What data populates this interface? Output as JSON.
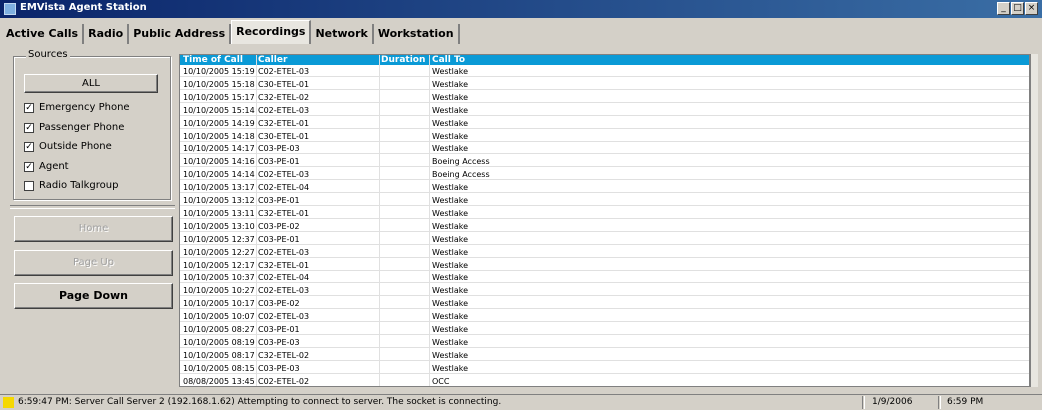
{
  "window": {
    "title": "EMVista Agent Station",
    "buttons": [
      "_",
      "□",
      "×"
    ]
  },
  "tabs": [
    {
      "label": "Active Calls",
      "active": false
    },
    {
      "label": "Radio",
      "active": false
    },
    {
      "label": "Public Address",
      "active": false
    },
    {
      "label": "Recordings",
      "active": true
    },
    {
      "label": "Network",
      "active": false
    },
    {
      "label": "Workstation",
      "active": false
    }
  ],
  "sources": {
    "legend": "Sources",
    "all_label": "ALL",
    "checks": [
      {
        "label": "Emergency Phone",
        "checked": true
      },
      {
        "label": "Passenger Phone",
        "checked": true
      },
      {
        "label": "Outside Phone",
        "checked": true
      },
      {
        "label": "Agent",
        "checked": true
      },
      {
        "label": "Radio Talkgroup",
        "checked": false
      }
    ]
  },
  "nav": {
    "home": "Home",
    "page_up": "Page Up",
    "page_down": "Page Down"
  },
  "table": {
    "headers": {
      "time": "Time of Call",
      "caller": "Caller",
      "duration": "Duration",
      "to": "Call To"
    },
    "rows": [
      {
        "time": "10/10/2005 15:19",
        "caller": "C02-ETEL-03",
        "duration": "",
        "to": "Westlake"
      },
      {
        "time": "10/10/2005 15:18",
        "caller": "C30-ETEL-01",
        "duration": "",
        "to": "Westlake"
      },
      {
        "time": "10/10/2005 15:17",
        "caller": "C32-ETEL-02",
        "duration": "",
        "to": "Westlake"
      },
      {
        "time": "10/10/2005 15:14",
        "caller": "C02-ETEL-03",
        "duration": "",
        "to": "Westlake"
      },
      {
        "time": "10/10/2005 14:19",
        "caller": "C32-ETEL-01",
        "duration": "",
        "to": "Westlake"
      },
      {
        "time": "10/10/2005 14:18",
        "caller": "C30-ETEL-01",
        "duration": "",
        "to": "Westlake"
      },
      {
        "time": "10/10/2005 14:17",
        "caller": "C03-PE-03",
        "duration": "",
        "to": "Westlake"
      },
      {
        "time": "10/10/2005 14:16",
        "caller": "C03-PE-01",
        "duration": "",
        "to": "Boeing Access"
      },
      {
        "time": "10/10/2005 14:14",
        "caller": "C02-ETEL-03",
        "duration": "",
        "to": "Boeing Access"
      },
      {
        "time": "10/10/2005 13:17",
        "caller": "C02-ETEL-04",
        "duration": "",
        "to": "Westlake"
      },
      {
        "time": "10/10/2005 13:12",
        "caller": "C03-PE-01",
        "duration": "",
        "to": "Westlake"
      },
      {
        "time": "10/10/2005 13:11",
        "caller": "C32-ETEL-01",
        "duration": "",
        "to": "Westlake"
      },
      {
        "time": "10/10/2005 13:10",
        "caller": "C03-PE-02",
        "duration": "",
        "to": "Westlake"
      },
      {
        "time": "10/10/2005 12:37",
        "caller": "C03-PE-01",
        "duration": "",
        "to": "Westlake"
      },
      {
        "time": "10/10/2005 12:27",
        "caller": "C02-ETEL-03",
        "duration": "",
        "to": "Westlake"
      },
      {
        "time": "10/10/2005 12:17",
        "caller": "C32-ETEL-01",
        "duration": "",
        "to": "Westlake"
      },
      {
        "time": "10/10/2005 10:37",
        "caller": "C02-ETEL-04",
        "duration": "",
        "to": "Westlake"
      },
      {
        "time": "10/10/2005 10:27",
        "caller": "C02-ETEL-03",
        "duration": "",
        "to": "Westlake"
      },
      {
        "time": "10/10/2005 10:17",
        "caller": "C03-PE-02",
        "duration": "",
        "to": "Westlake"
      },
      {
        "time": "10/10/2005 10:07",
        "caller": "C02-ETEL-03",
        "duration": "",
        "to": "Westlake"
      },
      {
        "time": "10/10/2005 08:27",
        "caller": "C03-PE-01",
        "duration": "",
        "to": "Westlake"
      },
      {
        "time": "10/10/2005 08:19",
        "caller": "C03-PE-03",
        "duration": "",
        "to": "Westlake"
      },
      {
        "time": "10/10/2005 08:17",
        "caller": "C32-ETEL-02",
        "duration": "",
        "to": "Westlake"
      },
      {
        "time": "10/10/2005 08:15",
        "caller": "C03-PE-03",
        "duration": "",
        "to": "Westlake"
      },
      {
        "time": "08/08/2005 13:45",
        "caller": "C02-ETEL-02",
        "duration": "",
        "to": "OCC"
      }
    ]
  },
  "status": {
    "indicator_color": "#f5d800",
    "message": "6:59:47 PM: Server Call Server 2 (192.168.1.62) Attempting to connect to server. The socket is connecting.",
    "date": "1/9/2006",
    "time": "6:59 PM"
  }
}
